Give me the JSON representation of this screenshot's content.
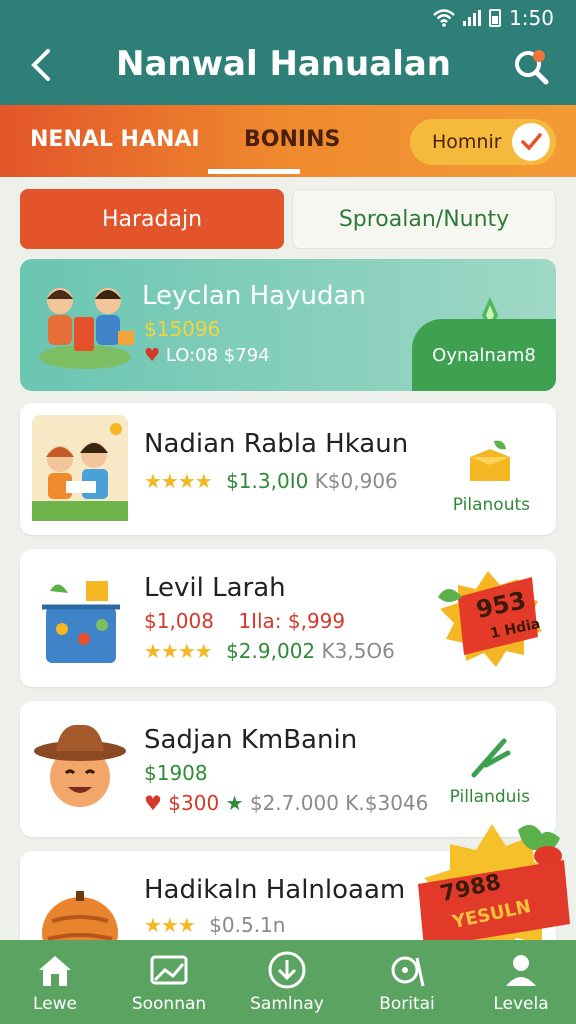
{
  "status": {
    "time": "1:50"
  },
  "header": {
    "title": "Nanwal Hanualan"
  },
  "tabs": {
    "tab1": "NENAL HANAI",
    "tab2": "BONINS",
    "pill_label": "Homnir"
  },
  "segments": {
    "left": "Haradajn",
    "right": "Sproalan/Nunty"
  },
  "featured": {
    "name": "Leyclan Hayudan",
    "price": "$15096",
    "meta": "LO:08 $794",
    "cta": "Oynalnam8"
  },
  "items": [
    {
      "name": "Nadian Rabla Hkaun",
      "line1_price": "$1.3,0I0",
      "line1_extra": "K$0,906",
      "category": "Pilanouts"
    },
    {
      "name": "Levil Larah",
      "line1_price": "$1,008",
      "line1_extra": "1Ila: $,999",
      "line2_price": "$2.9,002",
      "line2_extra": "K3,5O6"
    },
    {
      "name": "Sadjan KmBanin",
      "line1_price": "$1908",
      "line2_price": "$300",
      "line2_mid": "$2.7.000",
      "line2_extra": "K.$3046",
      "category": "Pillanduis"
    },
    {
      "name": "Hadikaln Halnloaam",
      "line1_price": "$0.5.1n"
    }
  ],
  "badges": {
    "levil": "953",
    "levil_sub": "1 Hdia",
    "promo": "7988",
    "promo_sub": "YESULN"
  },
  "nav": [
    "Lewe",
    "Soonnan",
    "Samlnay",
    "Boritai",
    "Levela"
  ],
  "colors": {
    "header": "#2e7f77",
    "accent": "#e3542a",
    "nav": "#5aa361"
  }
}
